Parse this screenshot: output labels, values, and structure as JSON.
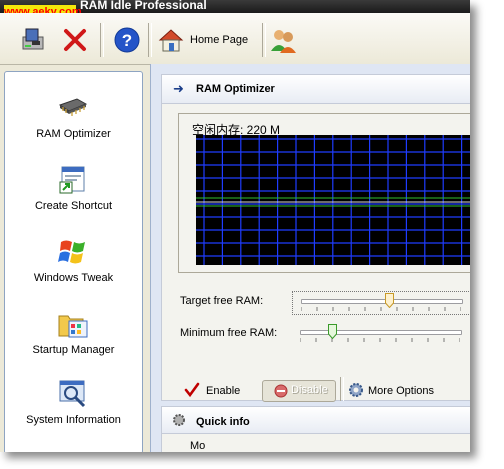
{
  "watermark": "www.aeky.com",
  "window": {
    "title": "RAM Idle Professional"
  },
  "toolbar": {
    "home_label": "Home Page"
  },
  "sidebar": {
    "items": [
      {
        "label": "RAM Optimizer",
        "icon": "memory-chip-icon"
      },
      {
        "label": "Create Shortcut",
        "icon": "shortcut-icon"
      },
      {
        "label": "Windows Tweak",
        "icon": "windows-logo-icon"
      },
      {
        "label": "Startup Manager",
        "icon": "startup-manager-icon"
      },
      {
        "label": "System Information",
        "icon": "system-info-icon"
      }
    ]
  },
  "panel": {
    "title": "RAM Optimizer",
    "free_memory_text": "空闲内存:  220 M",
    "target_label": "Target free RAM:",
    "minimum_label": "Minimum free RAM:",
    "target_level": 0.55,
    "minimum_level": 0.2,
    "enable_label": "Enable",
    "disable_label": "Disable",
    "more_label": "More Options"
  },
  "quick_info": {
    "title": "Quick info",
    "text": "Mo"
  },
  "colors": {
    "grid_line": "#1f3cff",
    "graph_bg": "#000000",
    "accent_red": "#c00000"
  }
}
